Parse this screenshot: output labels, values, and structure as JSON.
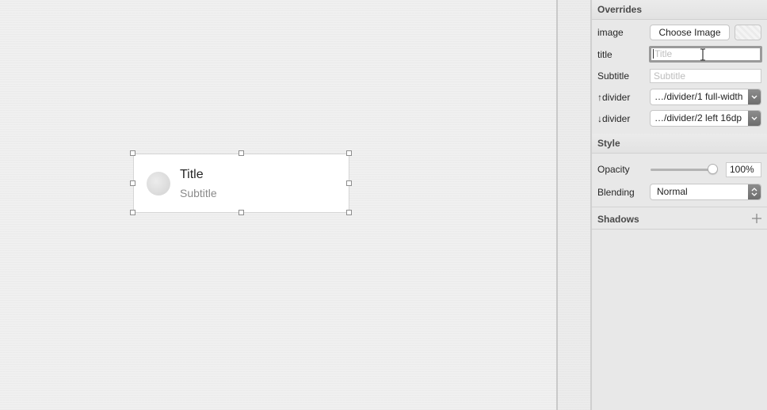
{
  "canvas": {
    "list_item": {
      "title": "Title",
      "subtitle": "Subtitle"
    }
  },
  "inspector": {
    "overrides": {
      "header": "Overrides",
      "image_label": "image",
      "choose_image_label": "Choose Image",
      "title_label": "title",
      "title_placeholder": "Title",
      "subtitle_label": "Subtitle",
      "subtitle_placeholder": "Subtitle",
      "up_divider_label": "↑divider",
      "up_divider_value": "…/divider/1 full-width",
      "down_divider_label": "↓divider",
      "down_divider_value": "…/divider/2 left 16dp"
    },
    "style": {
      "header": "Style",
      "opacity_label": "Opacity",
      "opacity_value": "100%",
      "opacity_level": 1.0,
      "blending_label": "Blending",
      "blending_value": "Normal"
    },
    "shadows": {
      "header": "Shadows"
    }
  },
  "icons": {
    "up_arrow": "arrow-up-icon",
    "down_arrow": "arrow-down-icon",
    "chevron": "chevron-down-icon",
    "stepper": "updown-icon",
    "add": "plus-icon",
    "text_cursor": "ibeam-cursor-icon"
  },
  "colors": {
    "focus_ring": "#9a9a9a",
    "canvas_bg": "#f0f0f0",
    "inspector_bg": "#e8e8e8"
  }
}
